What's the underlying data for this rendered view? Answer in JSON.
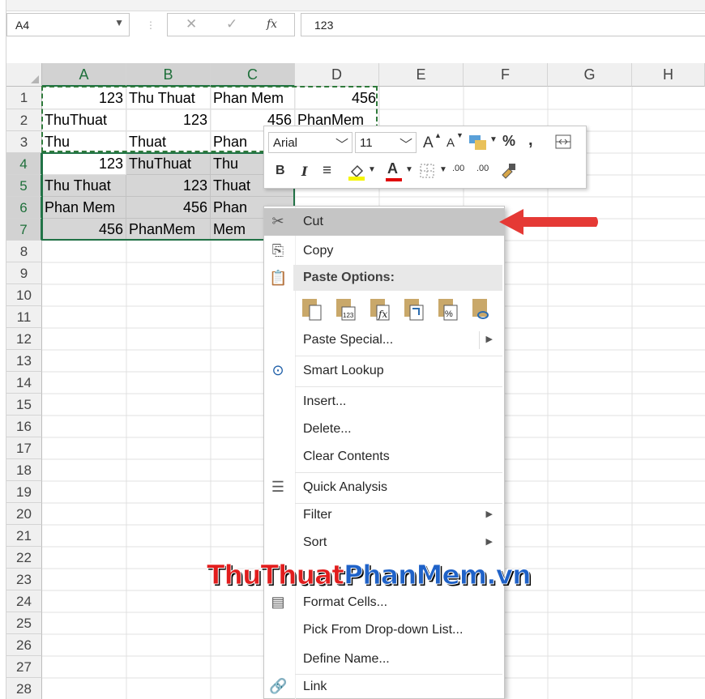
{
  "formula_bar": {
    "name_box": "A4",
    "cancel_icon": "✕",
    "enter_icon": "✓",
    "fx_label": "fx",
    "value": "123"
  },
  "columns": [
    "A",
    "B",
    "C",
    "D",
    "E",
    "F",
    "G",
    "H"
  ],
  "rows": [
    "1",
    "2",
    "3",
    "4",
    "5",
    "6",
    "7",
    "8",
    "9",
    "10",
    "11",
    "12",
    "13",
    "14",
    "15",
    "16",
    "17",
    "18",
    "19",
    "20",
    "21",
    "22",
    "23",
    "24",
    "25",
    "26",
    "27",
    "28"
  ],
  "cells": {
    "A1": "123",
    "B1": "Thu Thuat",
    "C1": "Phan Mem",
    "D1": "456",
    "A2": "ThuThuat",
    "B2": "123",
    "C2": "456",
    "D2": "PhanMem",
    "A3": "Thu",
    "B3": "Thuat",
    "C3": "Phan",
    "A4": "123",
    "B4": "ThuThuat",
    "C4": "Thu",
    "A5": "Thu Thuat",
    "B5": "123",
    "C5": "Thuat",
    "A6": "Phan Mem",
    "B6": "456",
    "C6": "Phan",
    "A7": "456",
    "B7": "PhanMem",
    "C7": "Mem"
  },
  "mini_toolbar": {
    "font": "Arial",
    "size": "11",
    "bold": "B",
    "italic": "I",
    "percent": "%",
    "comma": ",",
    "increase_font": "A",
    "decrease_font": "A",
    "font_color": "A",
    "inc_decimal": ".00",
    "dec_decimal": ".00"
  },
  "context_menu": {
    "cut": "Cut",
    "copy": "Copy",
    "paste_options": "Paste Options:",
    "paste_special": "Paste Special...",
    "smart_lookup": "Smart Lookup",
    "insert": "Insert...",
    "delete": "Delete...",
    "clear_contents": "Clear Contents",
    "quick_analysis": "Quick Analysis",
    "filter": "Filter",
    "sort": "Sort",
    "format_cells": "Format Cells...",
    "pick_from_list": "Pick From Drop-down List...",
    "define_name": "Define Name...",
    "link": "Link"
  },
  "watermark": {
    "part1": "ThuThuat",
    "part2": "PhanMem.vn"
  },
  "colors": {
    "excel_green": "#217346",
    "arrow_red": "#e53935",
    "highlight": "#c5c5c5"
  }
}
